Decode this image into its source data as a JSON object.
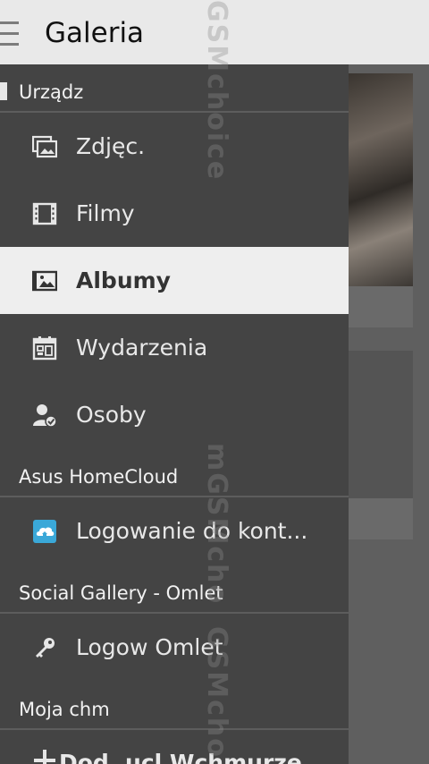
{
  "header": {
    "title": "Galeria"
  },
  "drawer": {
    "sections": {
      "device": {
        "label": "Urządz"
      },
      "homecloud": {
        "label": "Asus HomeCloud"
      },
      "social": {
        "label": "Social Gallery - Omlet"
      },
      "mine": {
        "label": "Moja chm"
      }
    },
    "items": {
      "photos": {
        "label": "Zdjęc.",
        "icon": "photos-icon"
      },
      "videos": {
        "label": "Filmy",
        "icon": "film-icon"
      },
      "albums": {
        "label": "Albumy",
        "icon": "album-icon"
      },
      "events": {
        "label": "Wydarzenia",
        "icon": "calendar-icon"
      },
      "people": {
        "label": "Osoby",
        "icon": "person-check-icon"
      },
      "homecloud_login": {
        "label": "Logowanie do kont...",
        "icon": "cloud-home-icon"
      },
      "omlet_login": {
        "label": "Logow Omlet",
        "icon": "key-icon"
      },
      "add_account": {
        "label": "Dod. ucl Wchmurze",
        "icon": "plus-icon"
      }
    }
  },
  "watermark": {
    "segments": [
      "GSMchoice",
      "mGSMcho",
      "GSMcho"
    ]
  },
  "colors": {
    "header_bg": "#e9e9e9",
    "drawer_bg": "#444444",
    "active_item_bg": "#eeeeee",
    "cloud_accent": "#3aa8d8"
  }
}
